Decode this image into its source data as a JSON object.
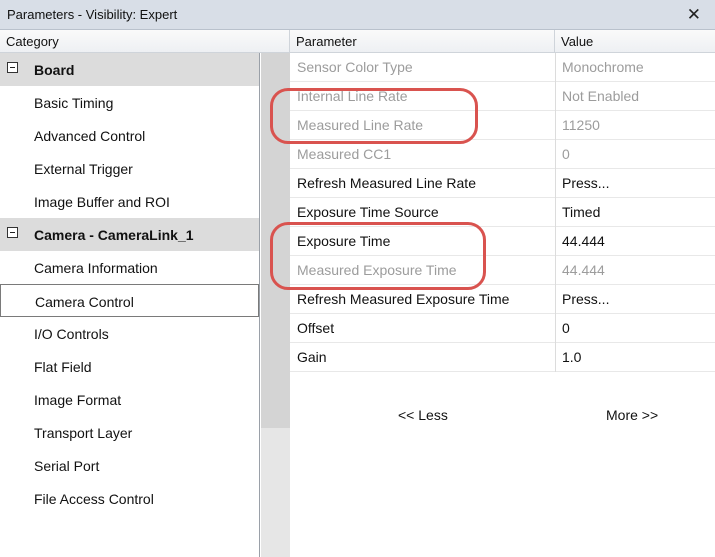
{
  "window": {
    "title": "Parameters - Visibility: Expert",
    "close_glyph": "✕"
  },
  "columns": {
    "category": "Category",
    "parameter": "Parameter",
    "value": "Value"
  },
  "categories": [
    {
      "label": "Board",
      "kind": "group"
    },
    {
      "label": "Basic Timing",
      "kind": "item"
    },
    {
      "label": "Advanced Control",
      "kind": "item"
    },
    {
      "label": "External Trigger",
      "kind": "item"
    },
    {
      "label": "Image Buffer and ROI",
      "kind": "item"
    },
    {
      "label": "Camera - CameraLink_1",
      "kind": "group"
    },
    {
      "label": "Camera Information",
      "kind": "item"
    },
    {
      "label": "Camera Control",
      "kind": "item",
      "selected": true
    },
    {
      "label": "I/O Controls",
      "kind": "item"
    },
    {
      "label": "Flat Field",
      "kind": "item"
    },
    {
      "label": "Image Format",
      "kind": "item"
    },
    {
      "label": "Transport Layer",
      "kind": "item"
    },
    {
      "label": "Serial Port",
      "kind": "item"
    },
    {
      "label": "File Access Control",
      "kind": "item"
    }
  ],
  "parameters": [
    {
      "name": "Sensor Color Type",
      "value": "Monochrome",
      "enabled": false
    },
    {
      "name": "Internal Line Rate",
      "value": "Not Enabled",
      "enabled": false
    },
    {
      "name": "Measured Line Rate",
      "value": "11250",
      "enabled": false
    },
    {
      "name": "Measured CC1",
      "value": "0",
      "enabled": false
    },
    {
      "name": "Refresh Measured Line Rate",
      "value": "Press...",
      "enabled": true
    },
    {
      "name": "Exposure Time Source",
      "value": "Timed",
      "enabled": true
    },
    {
      "name": "Exposure Time",
      "value": "44.444",
      "enabled": true
    },
    {
      "name": "Measured Exposure Time",
      "value": "44.444",
      "enabled": false
    },
    {
      "name": "Refresh Measured Exposure Time",
      "value": "Press...",
      "enabled": true
    },
    {
      "name": "Offset",
      "value": "0",
      "enabled": true
    },
    {
      "name": "Gain",
      "value": "1.0",
      "enabled": true
    }
  ],
  "links": {
    "less": "<< Less",
    "more": "More >>"
  },
  "colors": {
    "highlight": "#d9534f",
    "group_bg": "#dcdcdc",
    "disabled_text": "#9c9c9c"
  },
  "icons": {
    "expander": "collapse-icon"
  }
}
